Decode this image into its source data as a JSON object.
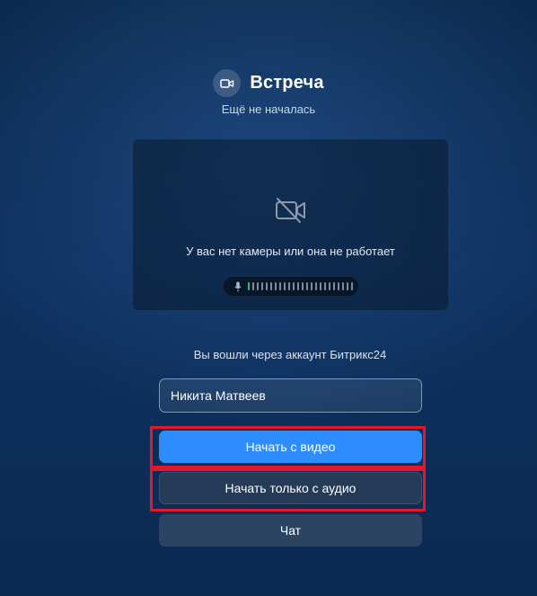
{
  "meeting": {
    "title": "Встреча",
    "status": "Ещё не началась",
    "header_icon": "video-camera-icon"
  },
  "preview": {
    "no_camera_text": "У вас нет камеры или она не работает",
    "no_camera_icon": "camera-off-icon",
    "mic_icon": "microphone-icon",
    "mic_level": 0.04
  },
  "account": {
    "text": "Вы вошли через аккаунт Битрикс24"
  },
  "name_field": {
    "value": "Никита Матвеев"
  },
  "buttons": {
    "start_video": "Начать с видео",
    "start_audio": "Начать только с аудио",
    "chat": "Чат"
  },
  "colors": {
    "primary": "#2d8cff",
    "highlight": "#e3182d",
    "mic_active": "#2fc26b"
  }
}
